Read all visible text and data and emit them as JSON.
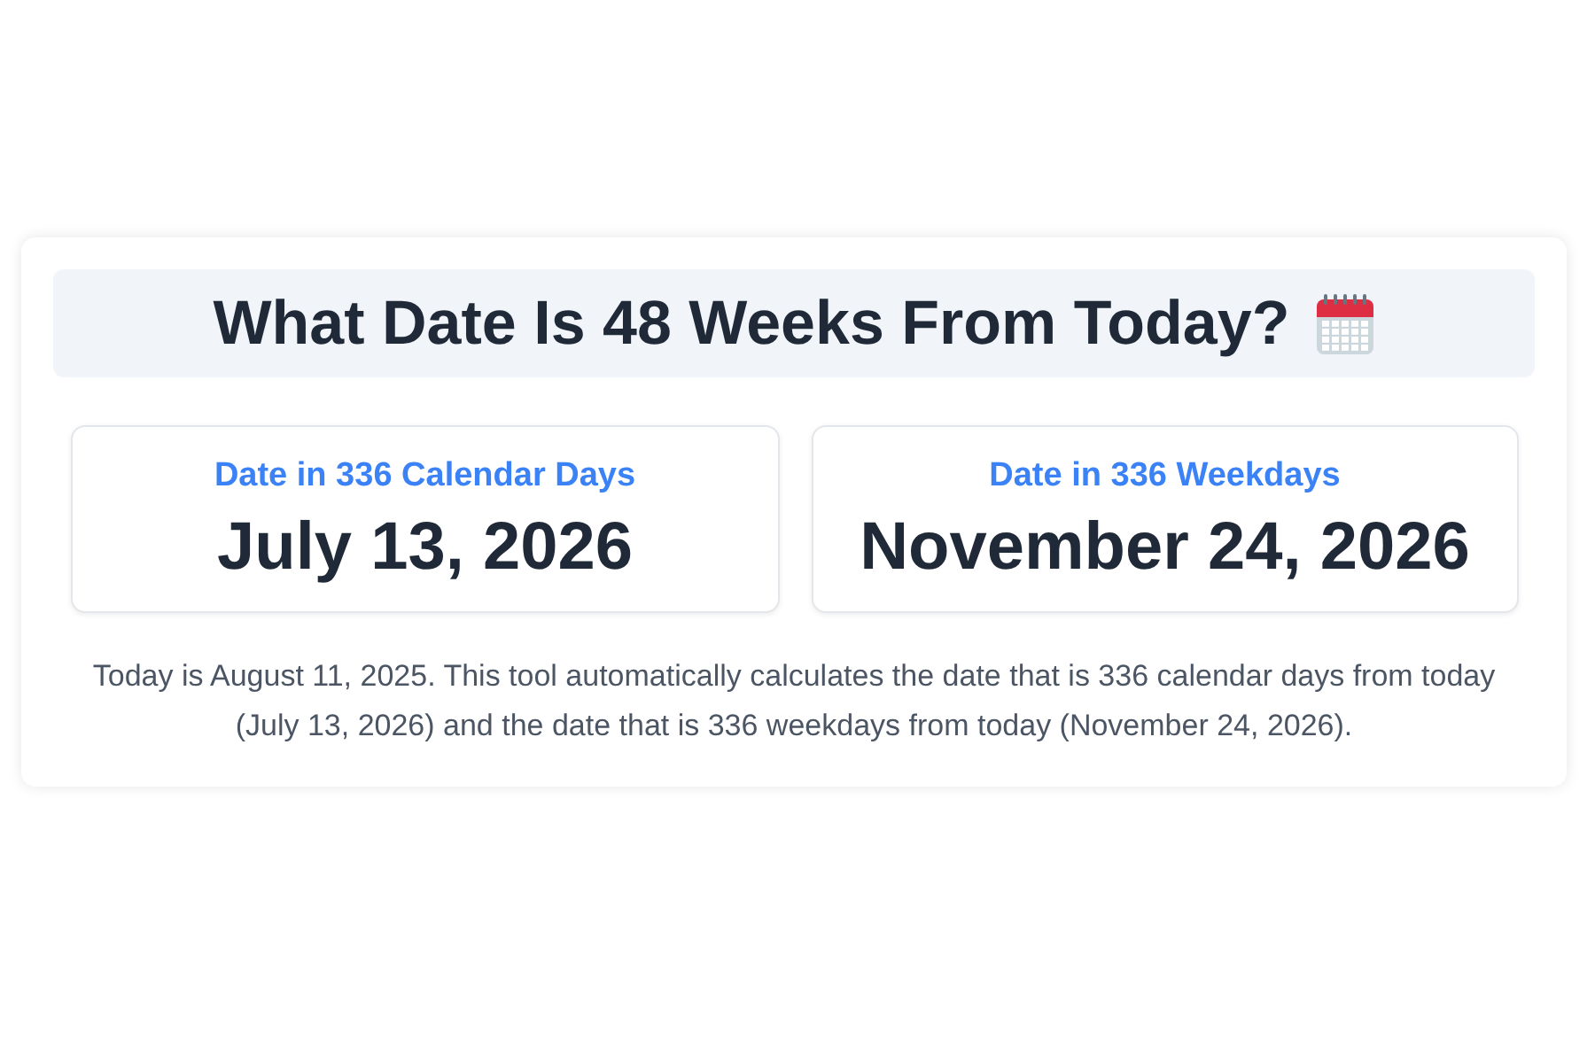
{
  "heading": {
    "title": "What Date Is 48 Weeks From Today?"
  },
  "results": [
    {
      "label": "Date in 336 Calendar Days",
      "date": "July 13, 2026"
    },
    {
      "label": "Date in 336 Weekdays",
      "date": "November 24, 2026"
    }
  ],
  "description": "Today is August 11, 2025. This tool automatically calculates the date that is 336 calendar days from today (July 13, 2026) and the date that is 336 weekdays from today (November 24, 2026)."
}
